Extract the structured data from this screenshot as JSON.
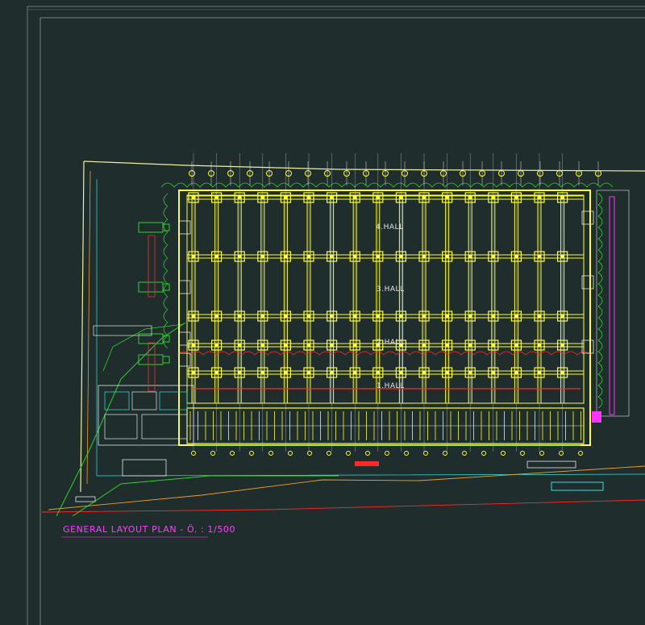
{
  "drawing": {
    "title": "GENERAL LAYOUT PLAN - Ö. : 1/500",
    "halls": [
      {
        "label": "4.HALL"
      },
      {
        "label": "3.HALL"
      },
      {
        "label": "2.HALL"
      },
      {
        "label": "1.HALL"
      }
    ]
  },
  "colors": {
    "background": "#1f2d2d",
    "structure": "#ffff33",
    "grid": "#e6e6e6",
    "landscape": "#2bd52b",
    "boundary": "#f0a020",
    "accent_red": "#ff2a2a",
    "accent_cyan": "#33e0e0",
    "accent_magenta": "#ff33ff",
    "title": "#ff3fff"
  }
}
